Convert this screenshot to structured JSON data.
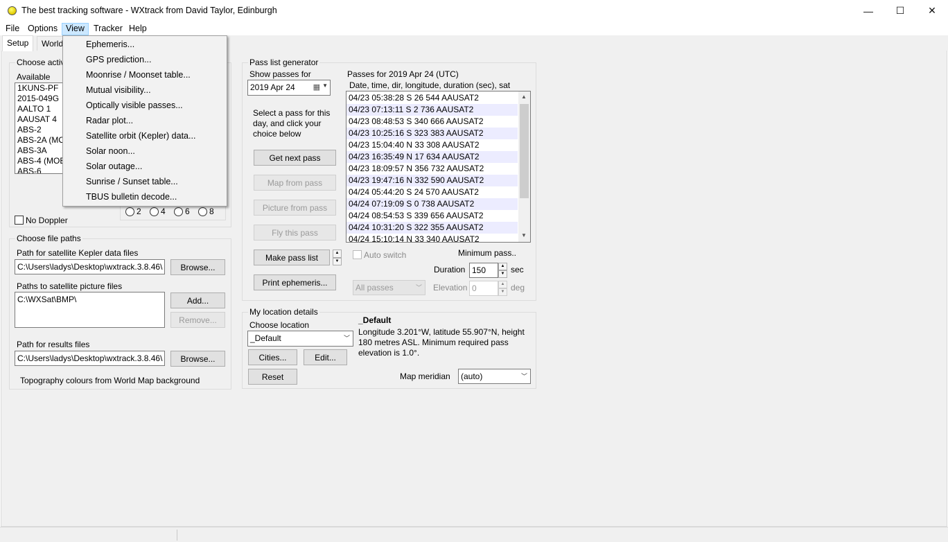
{
  "window": {
    "title": "The best tracking software - WXtrack from David Taylor, Edinburgh",
    "minimize": "—",
    "maximize": "☐",
    "close": "✕"
  },
  "menubar": {
    "file": "File",
    "options": "Options",
    "view": "View",
    "tracker": "Tracker",
    "help": "Help"
  },
  "tabs": {
    "setup": "Setup",
    "world": "World"
  },
  "view_menu": {
    "items": [
      "Ephemeris...",
      "GPS prediction...",
      "Moonrise / Moonset table...",
      "Mutual visibility...",
      "Optically visible passes...",
      "Radar plot...",
      "Satellite orbit (Kepler) data...",
      "Solar noon...",
      "Solar outage...",
      "Sunrise / Sunset table...",
      "TBUS bulletin decode..."
    ]
  },
  "active": {
    "group_title": "Choose active satellites",
    "available_label": "Available",
    "available_items": [
      "1KUNS-PF",
      "2015-049G",
      "AALTO 1",
      "AAUSAT 4",
      "ABS-2",
      "ABS-2A (MOBILE)",
      "ABS-3A",
      "ABS-4 (MOBILE)",
      "ABS-6"
    ],
    "radio_labels": [
      "2",
      "4",
      "6",
      "8"
    ],
    "no_doppler": "No Doppler"
  },
  "paths": {
    "group_title": "Choose file paths",
    "kepler_label": "Path for satellite Kepler data files",
    "kepler_value": "C:\\Users\\ladys\\Desktop\\wxtrack.3.8.46\\",
    "browse1": "Browse...",
    "picture_label": "Paths to satellite picture files",
    "picture_value": "C:\\WXSat\\BMP\\",
    "add": "Add...",
    "remove": "Remove...",
    "results_label": "Path for results files",
    "results_value": "C:\\Users\\ladys\\Desktop\\wxtrack.3.8.46\\",
    "browse2": "Browse...",
    "topography": "Topography colours from World Map background"
  },
  "passgen": {
    "group_title": "Pass list generator",
    "show_for": "Show passes for",
    "date_value": "2019  Apr  24",
    "instructions": [
      "Select a pass for this",
      "day, and click your",
      "choice below"
    ],
    "get_next": "Get next pass",
    "map_from": "Map from pass",
    "picture_from": "Picture from pass",
    "fly_this": "Fly this pass",
    "make_list": "Make pass list",
    "print_ephem": "Print ephemeris...",
    "passes_header": "Passes for 2019 Apr 24  (UTC)",
    "columns": "Date, time, dir, longitude, duration (sec), sat",
    "passes": [
      "04/23 05:38:28 S 26 544 AAUSAT2",
      "04/23 07:13:11 S 2 736 AAUSAT2",
      "04/23 08:48:53 S 340 666 AAUSAT2",
      "04/23 10:25:16 S 323 383 AAUSAT2",
      "04/23 15:04:40 N 33 308 AAUSAT2",
      "04/23 16:35:49 N 17 634 AAUSAT2",
      "04/23 18:09:57 N 356 732 AAUSAT2",
      "04/23 19:47:16 N 332 590 AAUSAT2",
      "04/24 05:44:20 S 24 570 AAUSAT2",
      "04/24 07:19:09 S 0 738 AAUSAT2",
      "04/24 08:54:53 S 339 656 AAUSAT2",
      "04/24 10:31:20 S 322 355 AAUSAT2",
      "04/24 15:10:14 N 33 340 AAUSAT2"
    ],
    "auto_switch": "Auto switch",
    "all_passes": "All passes",
    "min_pass": "Minimum pass..",
    "duration_label": "Duration",
    "duration_value": "150",
    "duration_unit": "sec",
    "elevation_label": "Elevation",
    "elevation_value": "0",
    "elevation_unit": "deg"
  },
  "location": {
    "group_title": "My location details",
    "choose_label": "Choose location",
    "location_value": "_Default",
    "cities": "Cities...",
    "edit": "Edit...",
    "reset": "Reset",
    "name": "_Default",
    "details": [
      "Longitude 3.201°W,  latitude 55.907°N,  height",
      "180 metres ASL.  Minimum required pass",
      "elevation is 1.0°."
    ],
    "meridian_label": "Map meridian",
    "meridian_value": "(auto)"
  }
}
